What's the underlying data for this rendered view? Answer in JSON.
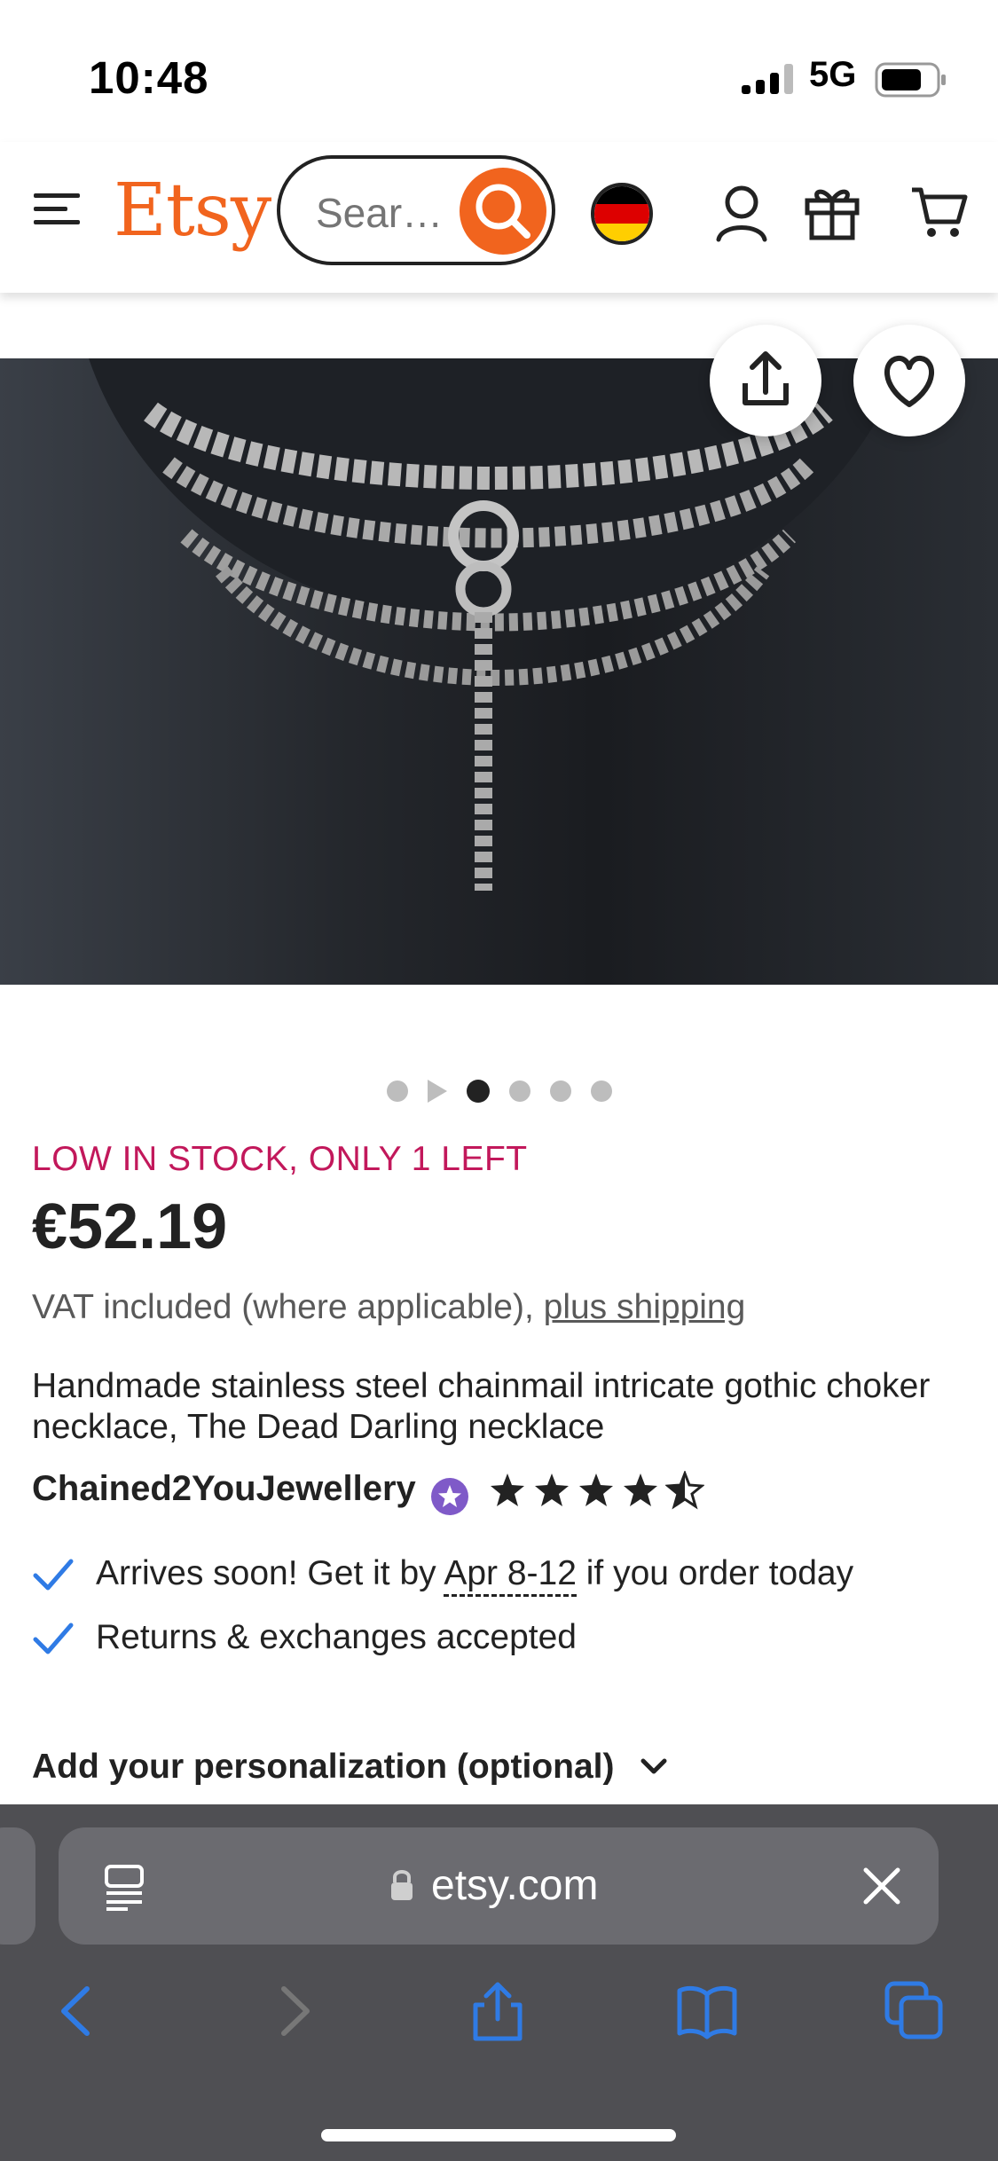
{
  "status_bar": {
    "time": "10:48",
    "network": "5G"
  },
  "header": {
    "logo": "Etsy",
    "search_placeholder": "Sear…",
    "icons": [
      "menu-icon",
      "search-icon",
      "flag-icon",
      "user-icon",
      "gift-icon",
      "cart-icon"
    ]
  },
  "carousel": {
    "count": 6,
    "active_index": 2,
    "video_index": 1
  },
  "listing": {
    "stock": "LOW IN STOCK, ONLY 1 LEFT",
    "price": "€52.19",
    "vat_text": "VAT included (where applicable), ",
    "shipping_link": "plus shipping",
    "title": "Handmade stainless steel chainmail intricate gothic choker necklace, The Dead Darling necklace",
    "shop": "Chained2YouJewellery",
    "rating": 4.5,
    "arrival_prefix": "Arrives soon! Get it by ",
    "arrival_date": "Apr 8-12",
    "arrival_suffix": " if you order today",
    "returns": "Returns & exchanges accepted",
    "personalization": "Add your personalization (optional)"
  },
  "browser": {
    "url": "etsy.com"
  },
  "colors": {
    "brand": "#f1641e",
    "stock": "#c2185b",
    "link": "#2f7be5"
  }
}
